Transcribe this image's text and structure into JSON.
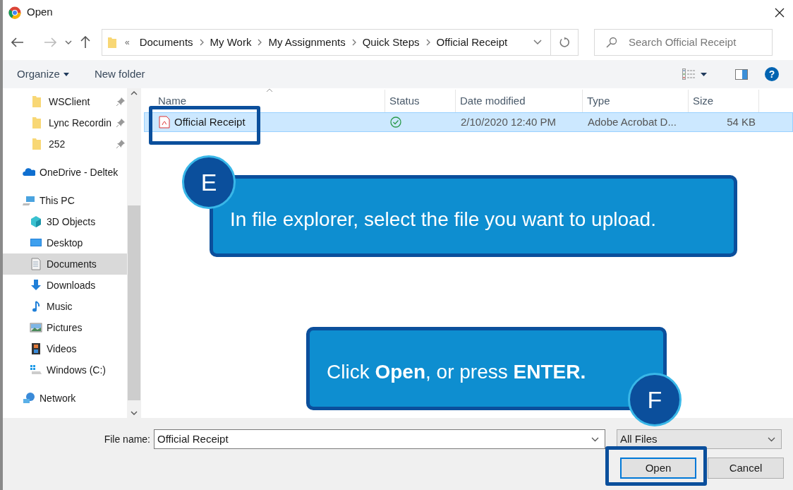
{
  "window": {
    "title": "Open"
  },
  "address": {
    "overflow": "«",
    "crumbs": [
      "Documents",
      "My Work",
      "My Assignments",
      "Quick Steps",
      "Official Receipt"
    ]
  },
  "search": {
    "placeholder": "Search Official Receipt"
  },
  "toolbar": {
    "organize": "Organize",
    "new_folder": "New folder",
    "help": "?"
  },
  "sidebar": {
    "items": [
      {
        "kind": "folder",
        "label": "WSClient",
        "pinned": true,
        "selected": false
      },
      {
        "kind": "folder",
        "label": "Lync Recordin",
        "pinned": true,
        "selected": false
      },
      {
        "kind": "folder",
        "label": "252",
        "pinned": true,
        "selected": false
      },
      {
        "kind": "onedrive",
        "label": "OneDrive - Deltek",
        "pinned": false,
        "selected": false
      },
      {
        "kind": "pc",
        "label": "This PC",
        "pinned": false,
        "selected": false,
        "children": [
          {
            "kind": "objects3d",
            "label": "3D Objects",
            "selected": false
          },
          {
            "kind": "desktop",
            "label": "Desktop",
            "selected": false
          },
          {
            "kind": "documents",
            "label": "Documents",
            "selected": true
          },
          {
            "kind": "downloads",
            "label": "Downloads",
            "selected": false
          },
          {
            "kind": "music",
            "label": "Music",
            "selected": false
          },
          {
            "kind": "pictures",
            "label": "Pictures",
            "selected": false
          },
          {
            "kind": "videos",
            "label": "Videos",
            "selected": false
          },
          {
            "kind": "drive",
            "label": "Windows (C:)",
            "selected": false
          }
        ]
      },
      {
        "kind": "network",
        "label": "Network",
        "pinned": false,
        "selected": false
      }
    ]
  },
  "table": {
    "columns": [
      "Name",
      "Status",
      "Date modified",
      "Type",
      "Size"
    ],
    "rows": [
      {
        "name": "Official Receipt",
        "synced": true,
        "date": "2/10/2020 12:40 PM",
        "type": "Adobe Acrobat D...",
        "size": "54 KB",
        "selected": true
      }
    ]
  },
  "footer": {
    "file_name_label": "File name:",
    "file_name": "Official Receipt",
    "filter": "All Files",
    "buttons": [
      "Open",
      "Cancel"
    ]
  },
  "callouts": [
    {
      "badge": "E",
      "text": "In file explorer, select the file you want to upload."
    },
    {
      "badge": "F",
      "text": "Click **Open**, or press **ENTER.**"
    }
  ]
}
